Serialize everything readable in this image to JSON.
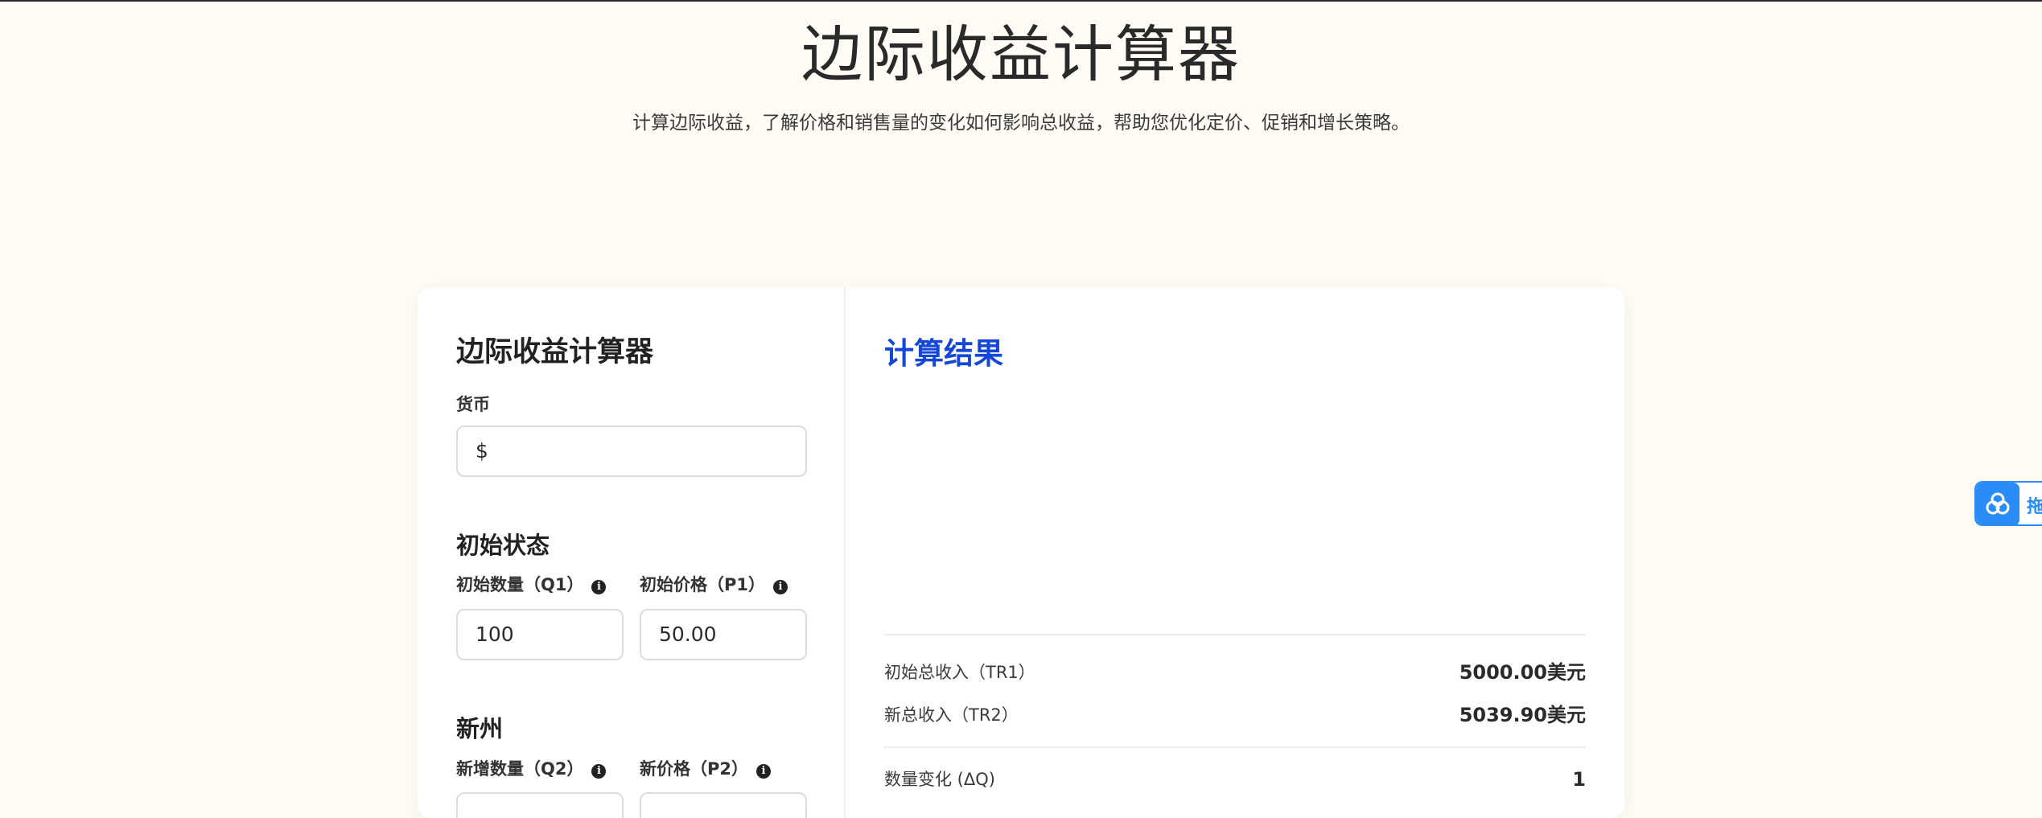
{
  "header": {
    "title": "边际收益计算器",
    "subtitle": "计算边际收益，了解价格和销售量的变化如何影响总收益，帮助您优化定价、促销和增长策略。"
  },
  "calculator": {
    "title": "边际收益计算器",
    "currency": {
      "label": "货币",
      "value": "$"
    },
    "initial_section": {
      "title": "初始状态",
      "quantity": {
        "label": "初始数量（Q1）",
        "value": "100"
      },
      "price": {
        "label": "初始价格（P1）",
        "value": "50.00"
      }
    },
    "new_section": {
      "title": "新州",
      "quantity": {
        "label": "新增数量（Q2）",
        "value": ""
      },
      "price": {
        "label": "新价格（P2）",
        "value": ""
      }
    }
  },
  "results": {
    "title": "计算结果",
    "rows": [
      {
        "label": "初始总收入（TR1）",
        "value": "5000.00美元"
      },
      {
        "label": "新总收入（TR2）",
        "value": "5039.90美元"
      },
      {
        "label": "数量变化 (ΔQ)",
        "value": "1"
      }
    ]
  },
  "side_widget": {
    "icon": "cloud-logo-icon",
    "label": "拖",
    "color": "#2a8df7"
  },
  "colors": {
    "accent": "#1547d6",
    "background": "#fffcf5"
  }
}
